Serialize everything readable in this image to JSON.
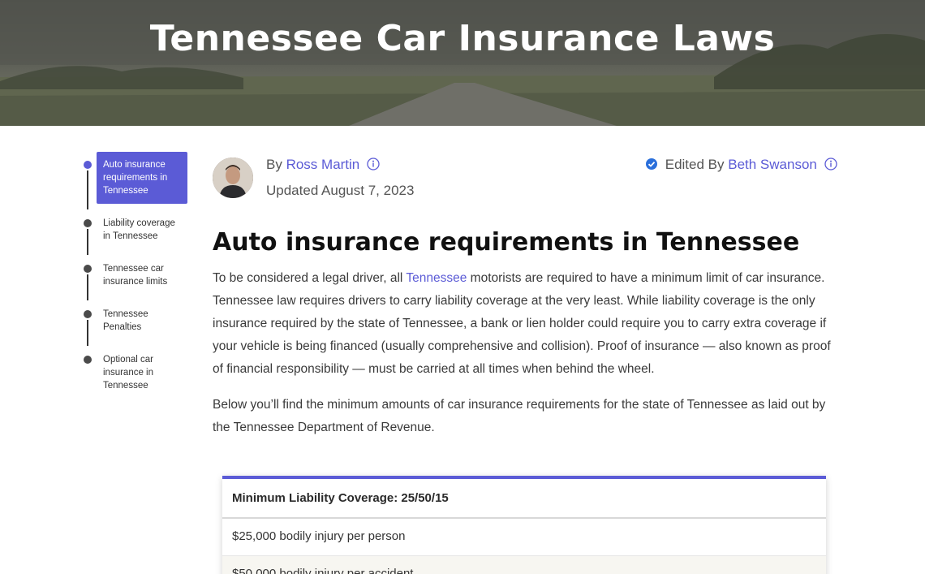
{
  "hero": {
    "title": "Tennessee Car Insurance Laws"
  },
  "toc": {
    "items": [
      {
        "label": "Auto insurance requirements in Tennessee"
      },
      {
        "label": "Liability coverage in Tennessee"
      },
      {
        "label": "Tennessee car insurance limits"
      },
      {
        "label": "Tennessee Penalties"
      },
      {
        "label": "Optional car insurance in Tennessee"
      }
    ]
  },
  "author": {
    "by_prefix": "By",
    "name": "Ross Martin",
    "updated": "Updated August 7, 2023",
    "edited_prefix": "Edited By",
    "editor": "Beth Swanson"
  },
  "article": {
    "heading": "Auto insurance requirements in Tennessee",
    "p1_before_link": "To be considered a legal driver, all ",
    "p1_link": "Tennessee",
    "p1_after_link": " motorists are required to have a minimum limit of car insurance. Tennessee law requires drivers to carry liability coverage at the very least. While liability coverage is the only insurance required by the state of Tennessee, a bank or lien holder could require you to carry extra coverage if your vehicle is being financed (usually comprehensive and collision). Proof of insurance — also known as proof of financial responsibility — must be carried at all times when behind the wheel.",
    "p2": "Below you’ll find the minimum amounts of car insurance requirements for the state of Tennessee as laid out by the Tennessee Department of Revenue."
  },
  "table": {
    "header": "Minimum Liability Coverage: 25/50/15",
    "rows": [
      "$25,000 bodily injury per person",
      "$50,000 bodily injury per accident"
    ]
  },
  "colors": {
    "accent": "#5b5bd6",
    "verified": "#2a6fdb"
  }
}
